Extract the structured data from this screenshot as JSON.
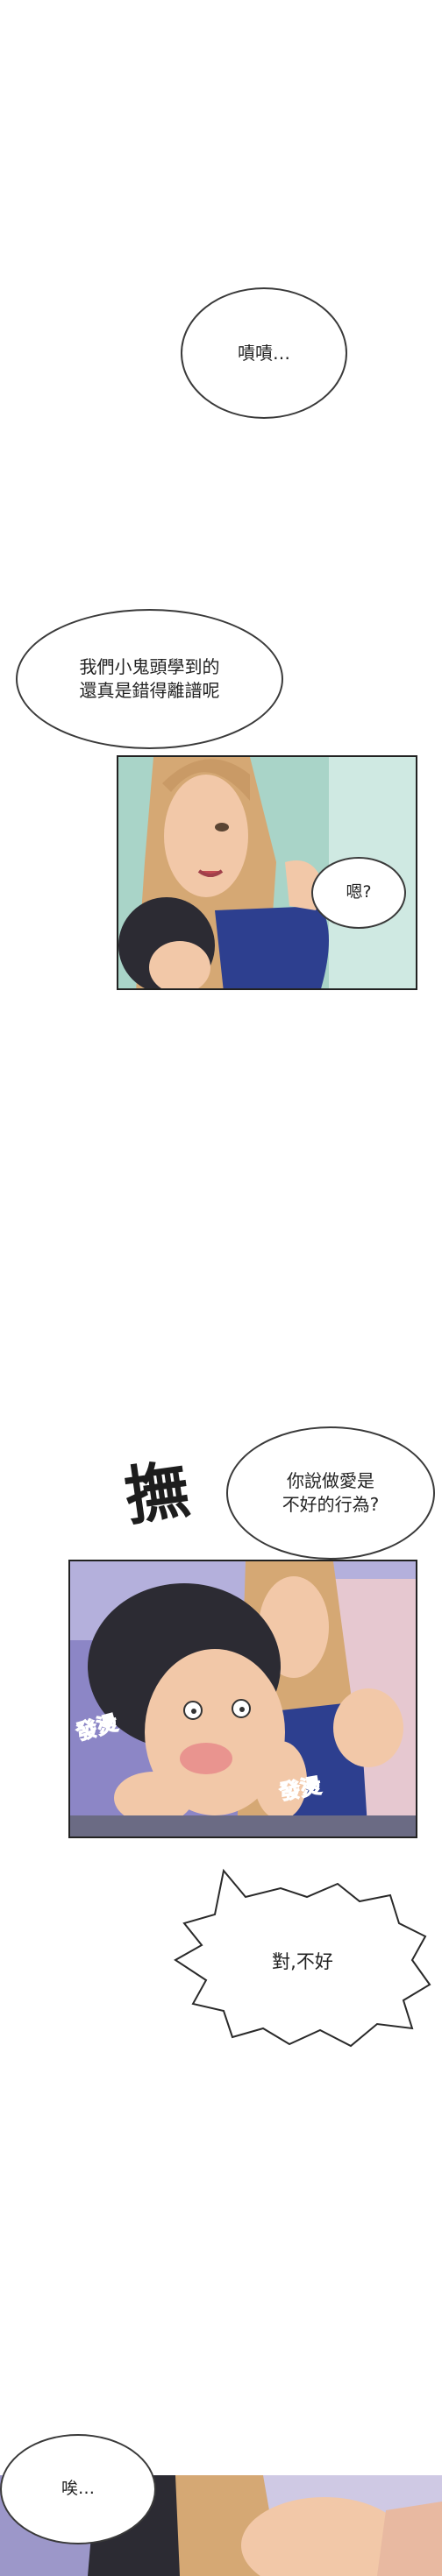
{
  "page": {
    "background": "#ffffff"
  },
  "bubbles": {
    "b1": "嘖嘖…",
    "b2": "我們小鬼頭學到的\n還真是錯得離譜呢",
    "b3": "嗯?",
    "b4": "你說做愛是\n不好的行為?",
    "b5": "對,不好",
    "b6": "唉…"
  },
  "sfx": {
    "s1": "撫",
    "s2": "發燙",
    "s3": "發燙"
  },
  "colors": {
    "skin": "#f2c8a8",
    "hair_dark": "#2c2b33",
    "hair_blonde": "#d5a874",
    "swimsuit": "#2d3f8f",
    "bg_teal": "#a9d4c8",
    "bg_purple": "#8c86c6",
    "sfx_blue": "#6aa5d8"
  }
}
